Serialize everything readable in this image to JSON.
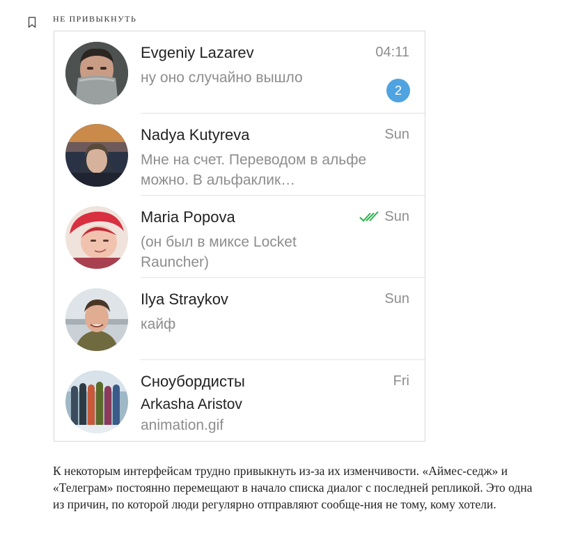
{
  "section": {
    "label": "НЕ ПРИВЫКНУТЬ",
    "icon": "bookmark-icon"
  },
  "chats": [
    {
      "name": "Evgeniy Lazarev",
      "time": "04:11",
      "preview": "ну оно случайно вышло",
      "unread": "2"
    },
    {
      "name": "Nadya Kutyreva",
      "time": "Sun",
      "preview": "Мне на счет. Переводом в альфе можно. В альфаклик…"
    },
    {
      "name": "Maria Popova",
      "time": "Sun",
      "preview": "(он был в миксе Locket Rauncher)",
      "status_icon": "double-check-icon",
      "status_color": "#2bb24c"
    },
    {
      "name": "Ilya Straykov",
      "time": "Sun",
      "preview": "кайф"
    },
    {
      "name": "Сноубордисты",
      "time": "Fri",
      "sender": "Arkasha Aristov",
      "preview": "animation.gif"
    }
  ],
  "colors": {
    "badge": "#4fa3e0",
    "muted_text": "#8d8d8d",
    "divider": "#e3e3e3"
  },
  "article": {
    "paragraph": "К некоторым интерфейсам трудно привыкнуть из-за их изменчивости. «Аймес-седж» и «Телеграм» постоянно перемещают в начало списка диалог с последней репликой. Это одна из причин, по которой люди регулярно отправляют сообще-ния не тому, кому хотели."
  }
}
